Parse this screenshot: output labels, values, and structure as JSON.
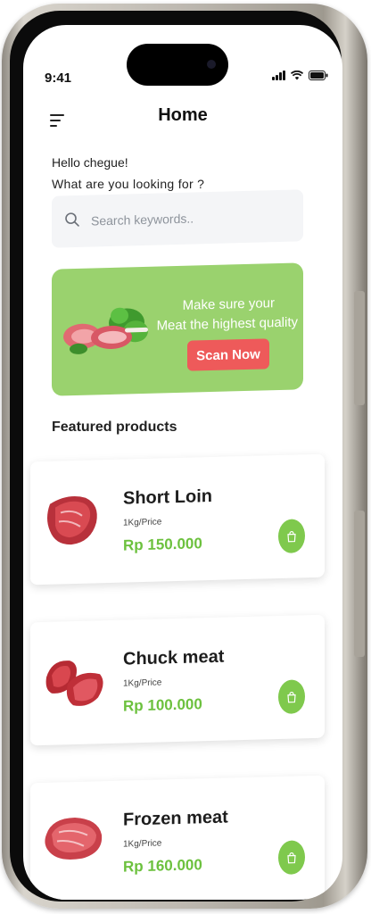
{
  "status_bar": {
    "time": "9:41"
  },
  "header": {
    "title": "Home"
  },
  "greeting": {
    "hello": "Hello chegue!",
    "question": "What are you looking for ?"
  },
  "search": {
    "placeholder": "Search keywords.."
  },
  "banner": {
    "line1": "Make sure your",
    "line2": "Meat the highest quality",
    "button": "Scan Now"
  },
  "featured": {
    "title": "Featured products",
    "products": [
      {
        "name": "Short Loin",
        "unit": "1Kg/Price",
        "price": "Rp 150.000"
      },
      {
        "name": "Chuck meat",
        "unit": "1Kg/Price",
        "price": "Rp 100.000"
      },
      {
        "name": "Frozen meat",
        "unit": "1Kg/Price",
        "price": "Rp 160.000"
      }
    ]
  },
  "colors": {
    "accent_green": "#9ad26e",
    "price_green": "#6cc13e",
    "button_red": "#ee5a5a",
    "cart_green": "#7fc94d"
  },
  "icons": [
    "menu-icon",
    "search-icon",
    "cart-icon",
    "signal-icon",
    "wifi-icon",
    "battery-icon"
  ]
}
